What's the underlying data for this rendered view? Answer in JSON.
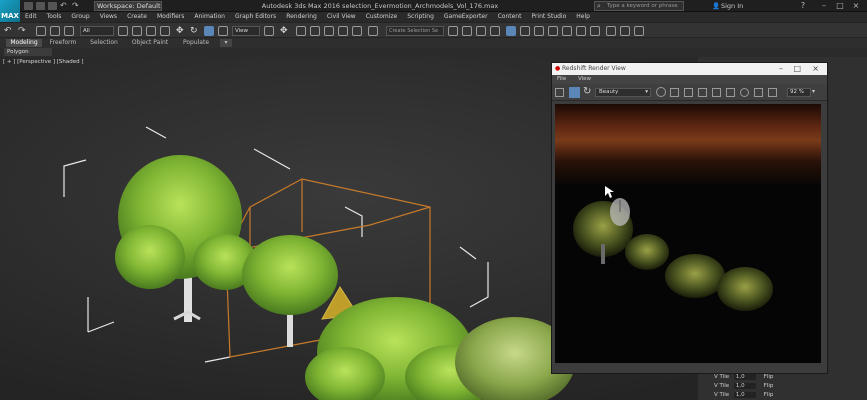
{
  "app": {
    "logo_text": "MAX",
    "workspace": "Workspace: Default",
    "title": "Autodesk 3ds Max 2016    selection_Evermotion_Archmodels_Vol_176.max",
    "search_placeholder": "Type a keyword or phrase",
    "signin": "Sign In",
    "colors": {
      "accent": "#5a87b8",
      "viewport_bg": "#2b2b2b",
      "selection_orange": "#c77a2a"
    }
  },
  "menu": [
    "Edit",
    "Tools",
    "Group",
    "Views",
    "Create",
    "Modifiers",
    "Animation",
    "Graph Editors",
    "Rendering",
    "Civil View",
    "Customize",
    "Scripting",
    "GameExporter",
    "Content",
    "Print Studio",
    "Help"
  ],
  "toolbar": {
    "filter": "All",
    "view_dropdown": "View",
    "selection_set_placeholder": "Create Selection Se"
  },
  "ribbon": {
    "tabs": [
      "Modeling",
      "Freeform",
      "Selection",
      "Object Paint",
      "Populate"
    ],
    "active_tab": "Modeling",
    "sub_label": "Polygon Modeling"
  },
  "viewport": {
    "label": "[ + ] [Perspective ] [Shaded ]"
  },
  "render_window": {
    "title": "Redshift Render View",
    "menu": [
      "File",
      "View"
    ],
    "aov": "Beauty",
    "zoom": "92 %"
  },
  "right_panel": {
    "rows": [
      {
        "label": "V Tile",
        "value": "1,0",
        "flip": "Flip"
      },
      {
        "label": "V Tile",
        "value": "1,0",
        "flip": "Flip"
      },
      {
        "label": "V Tile",
        "value": "1,0",
        "flip": "Flip"
      }
    ]
  }
}
